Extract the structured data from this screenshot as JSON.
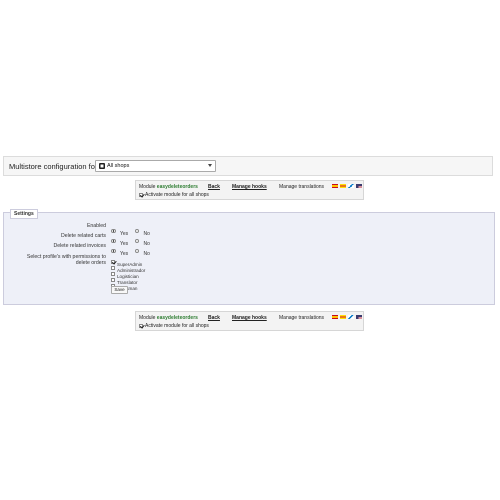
{
  "multistore": {
    "label": "Multistore configuration for",
    "selected_shop": "All shops"
  },
  "module_bar": {
    "module_prefix": "Module",
    "module_name": "easydeleteorders",
    "back_label": "Back",
    "manage_hooks_label": "Manage hooks",
    "manage_translations_label": "Manage translations",
    "activate_all_label": "Activate module for all shops",
    "activate_all_checked": true,
    "translation_flags": [
      "es",
      "ca",
      "gl",
      "us"
    ]
  },
  "settings": {
    "legend": "Settings",
    "enabled": {
      "label": "Enabled",
      "value": "Yes"
    },
    "delete_related_carts": {
      "label": "Delete related carts",
      "value": "Yes"
    },
    "delete_related_invoices": {
      "label": "Delete related invoices",
      "value": "Yes"
    },
    "yes_label": "Yes",
    "no_label": "No",
    "profiles_label_line1": "Select profile's with permissions to",
    "profiles_label_line2": "delete orders",
    "profiles": [
      {
        "name": "SuperAdmin",
        "checked": true
      },
      {
        "name": "Administrador",
        "checked": false
      },
      {
        "name": "Logistician",
        "checked": false
      },
      {
        "name": "Translator",
        "checked": false
      },
      {
        "name": "Salesman",
        "checked": false
      }
    ],
    "save_label": "Save"
  },
  "colors": {
    "module_name": "#2e7d32",
    "settings_bg": "#eef0f8"
  }
}
